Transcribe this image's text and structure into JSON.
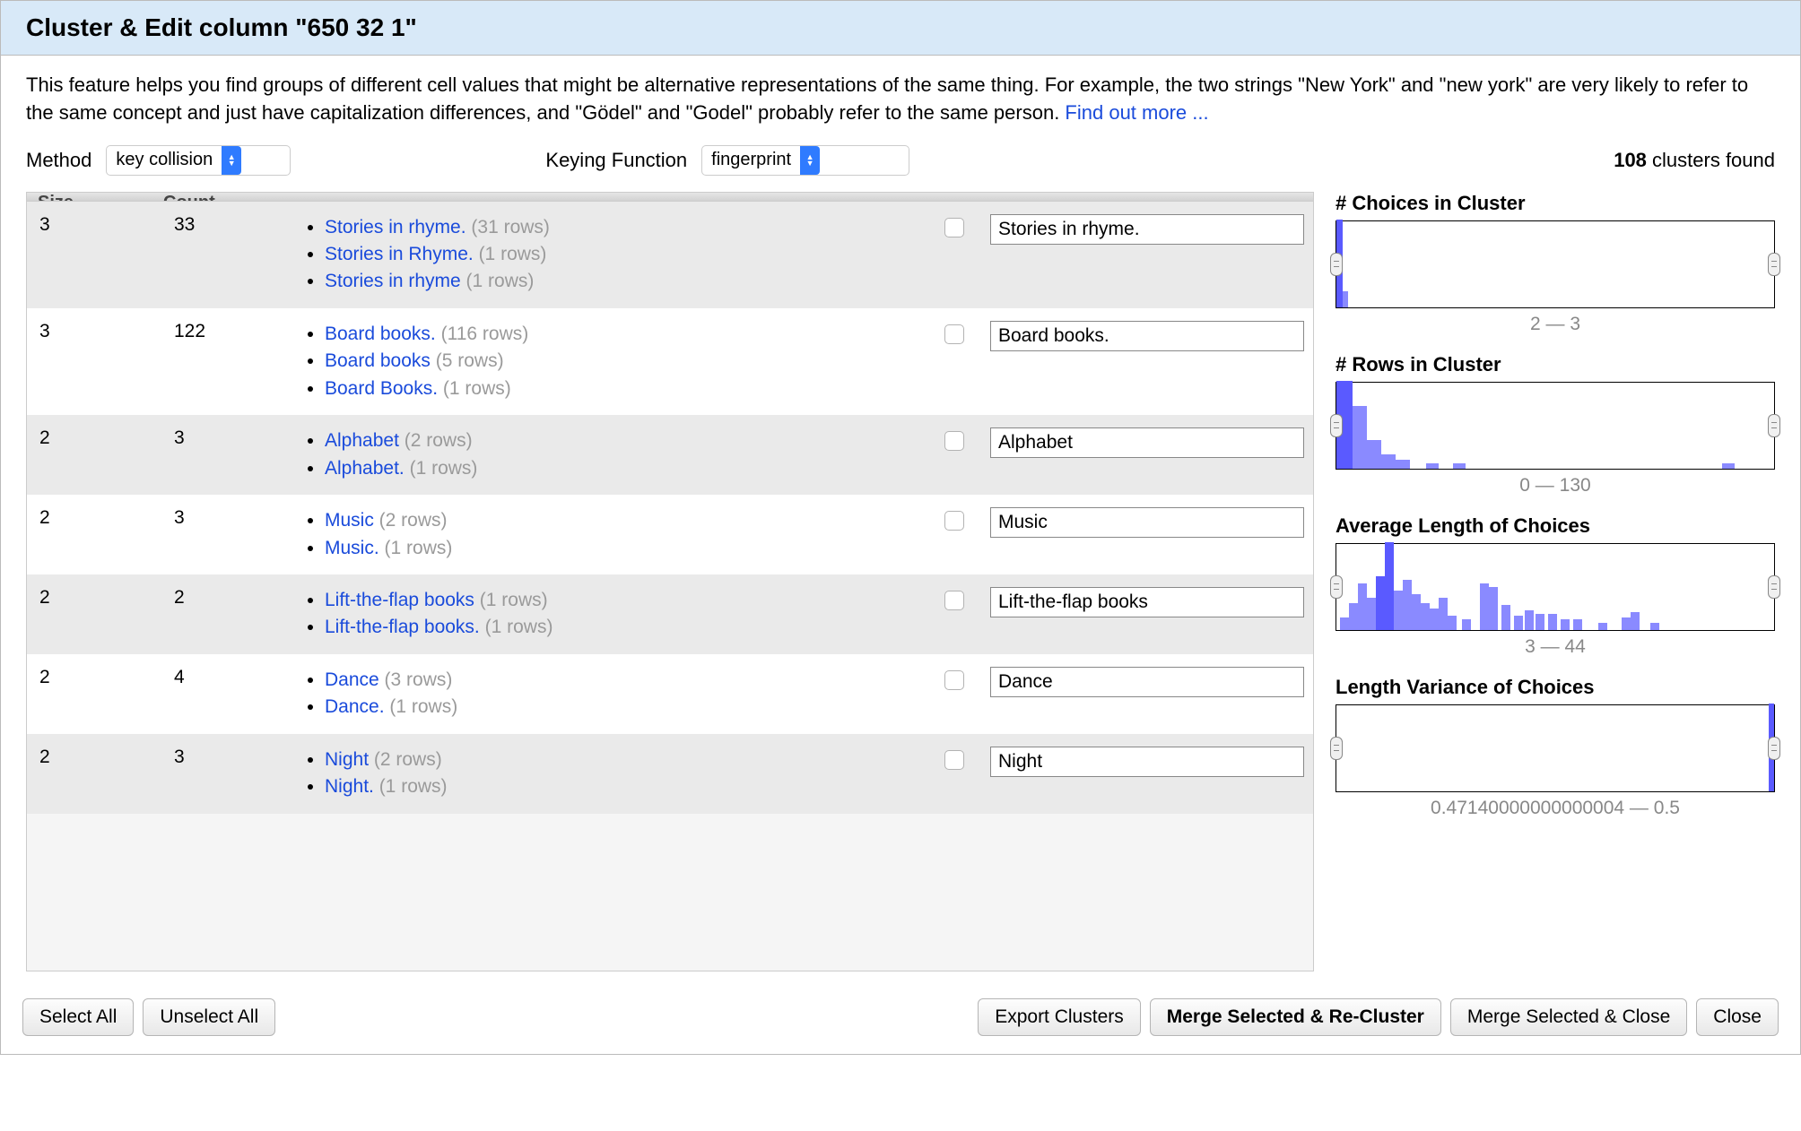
{
  "header": {
    "title": "Cluster & Edit column \"650 32 1\""
  },
  "intro": {
    "text": "This feature helps you find groups of different cell values that might be alternative representations of the same thing. For example, the two strings \"New York\" and \"new york\" are very likely to refer to the same concept and just have capitalization differences, and \"Gödel\" and \"Godel\" probably refer to the same person. ",
    "link_text": "Find out more ..."
  },
  "controls": {
    "method_label": "Method",
    "method_value": "key collision",
    "keying_label": "Keying Function",
    "keying_value": "fingerprint",
    "count_bold": "108",
    "count_suffix": " clusters found"
  },
  "columns": {
    "size": "Size",
    "count": "Count"
  },
  "clusters": [
    {
      "size": "3",
      "count": "33",
      "merge_value": "Stories in rhyme.",
      "values": [
        {
          "label": "Stories in rhyme.",
          "rows": "(31 rows)"
        },
        {
          "label": "Stories in Rhyme.",
          "rows": "(1 rows)"
        },
        {
          "label": "Stories in rhyme",
          "rows": "(1 rows)"
        }
      ]
    },
    {
      "size": "3",
      "count": "122",
      "merge_value": "Board books.",
      "values": [
        {
          "label": "Board books.",
          "rows": "(116 rows)"
        },
        {
          "label": "Board books",
          "rows": "(5 rows)"
        },
        {
          "label": "Board Books.",
          "rows": "(1 rows)"
        }
      ]
    },
    {
      "size": "2",
      "count": "3",
      "merge_value": "Alphabet",
      "values": [
        {
          "label": "Alphabet",
          "rows": "(2 rows)"
        },
        {
          "label": "Alphabet.",
          "rows": "(1 rows)"
        }
      ]
    },
    {
      "size": "2",
      "count": "3",
      "merge_value": "Music",
      "values": [
        {
          "label": "Music",
          "rows": "(2 rows)"
        },
        {
          "label": "Music.",
          "rows": "(1 rows)"
        }
      ]
    },
    {
      "size": "2",
      "count": "2",
      "merge_value": "Lift-the-flap books",
      "values": [
        {
          "label": "Lift-the-flap books",
          "rows": "(1 rows)"
        },
        {
          "label": "Lift-the-flap books.",
          "rows": "(1 rows)"
        }
      ]
    },
    {
      "size": "2",
      "count": "4",
      "merge_value": "Dance",
      "values": [
        {
          "label": "Dance",
          "rows": "(3 rows)"
        },
        {
          "label": "Dance.",
          "rows": "(1 rows)"
        }
      ]
    },
    {
      "size": "2",
      "count": "3",
      "merge_value": "Night",
      "values": [
        {
          "label": "Night",
          "rows": "(2 rows)"
        },
        {
          "label": "Night.",
          "rows": "(1 rows)"
        }
      ]
    }
  ],
  "histograms": {
    "choices": {
      "title": "# Choices in Cluster",
      "range": "2 — 3"
    },
    "rows": {
      "title": "# Rows in Cluster",
      "range": "0 — 130"
    },
    "avg_len": {
      "title": "Average Length of Choices",
      "range": "3 — 44"
    },
    "len_var": {
      "title": "Length Variance of Choices",
      "range": "0.47140000000000004 — 0.5"
    }
  },
  "buttons": {
    "select_all": "Select All",
    "unselect_all": "Unselect All",
    "export": "Export Clusters",
    "merge_recluster": "Merge Selected & Re-Cluster",
    "merge_close": "Merge Selected & Close",
    "close": "Close"
  }
}
